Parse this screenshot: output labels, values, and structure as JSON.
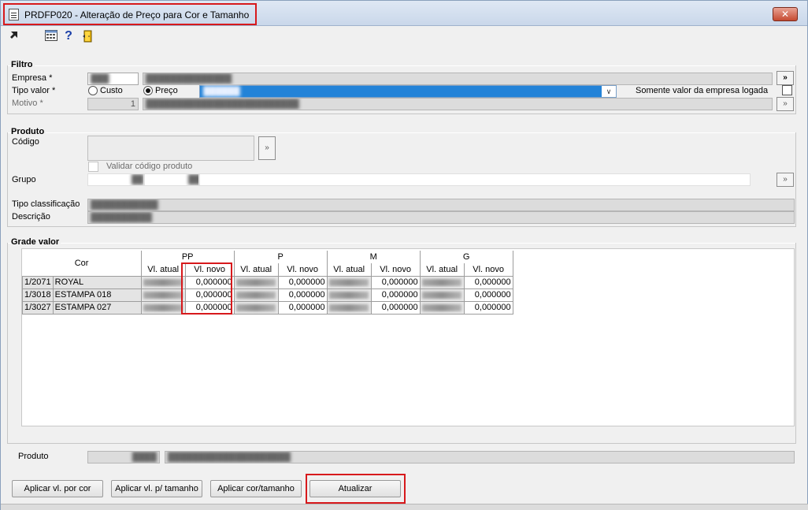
{
  "window": {
    "title": "PRDFP020 - Alteração de Preço para Cor e Tamanho",
    "close_label": "✕"
  },
  "toolbar": {
    "icons": [
      "arrow-icon",
      "calculator-icon",
      "help-icon",
      "exit-door-icon"
    ]
  },
  "filtro": {
    "title": "Filtro",
    "empresa_label": "Empresa *",
    "empresa_code": "███",
    "empresa_name": "██████████████",
    "tipo_label": "Tipo valor *",
    "custo_label": "Custo",
    "preco_label": "Preço",
    "tipo_selected": "██████",
    "somente_label": "Somente valor da empresa logada",
    "motivo_label": "Motivo *",
    "motivo_code": "1",
    "motivo_name": "█████████████████████████",
    "go_label": "»",
    "lookup_label": "»"
  },
  "produto": {
    "title": "Produto",
    "codigo_label": "Código",
    "validar_label": "Validar código produto",
    "grupo_label": "Grupo",
    "grupo_code": "██",
    "grupo_sub": "██",
    "tipo_class_label": "Tipo classificação",
    "tipo_class_value": "███████████",
    "descricao_label": "Descrição",
    "descricao_value": "██████████",
    "lookup_label": "»"
  },
  "grade": {
    "title": "Grade valor",
    "cor_header": "Cor",
    "sizes": [
      "PP",
      "P",
      "M",
      "G"
    ],
    "atual_header": "Vl. atual",
    "novo_header": "Vl. novo",
    "rows": [
      {
        "code": "1/2071",
        "name": "ROYAL",
        "novo": [
          "0,000000",
          "0,000000",
          "0,000000",
          "0,000000"
        ]
      },
      {
        "code": "1/3018",
        "name": "ESTAMPA 018",
        "novo": [
          "0,000000",
          "0,000000",
          "0,000000",
          "0,000000"
        ]
      },
      {
        "code": "1/3027",
        "name": "ESTAMPA 027",
        "novo": [
          "0,000000",
          "0,000000",
          "0,000000",
          "0,000000"
        ]
      }
    ]
  },
  "footer": {
    "produto_label": "Produto",
    "produto_code": "████",
    "produto_desc": "████████████████████"
  },
  "buttons": {
    "aplicar_cor": "Aplicar vl. por cor",
    "aplicar_tamanho": "Aplicar vl. p/ tamanho",
    "aplicar_cor_tamanho": "Aplicar cor/tamanho",
    "atualizar": "Atualizar"
  },
  "colors": {
    "highlight": "#d7191c",
    "selection": "#2383d8"
  }
}
